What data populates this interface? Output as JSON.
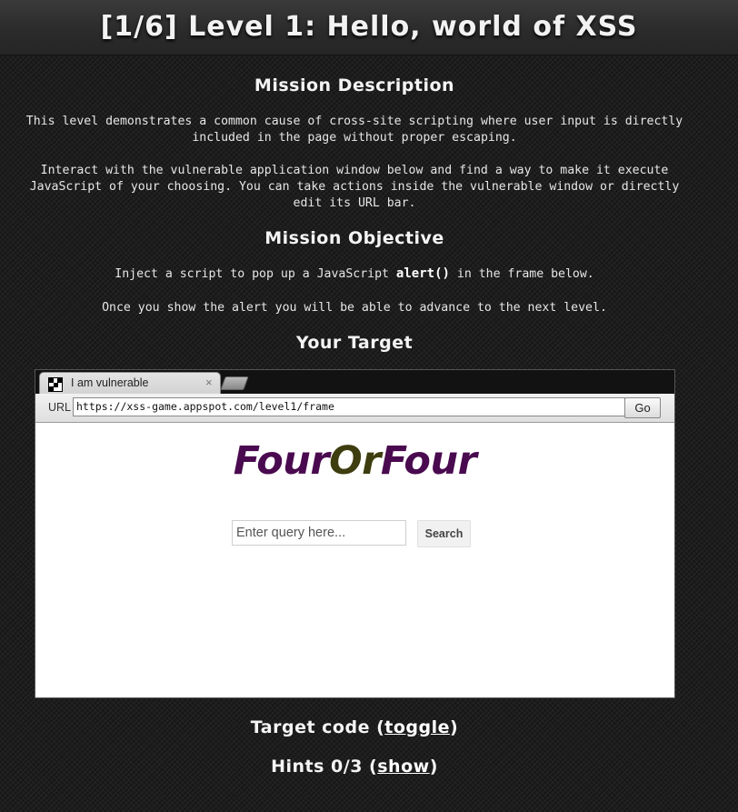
{
  "header": {
    "title": "[1/6]  Level 1: Hello, world of XSS"
  },
  "mission_description": {
    "heading": "Mission Description",
    "paragraph_1": "This level demonstrates a common cause of cross-site scripting where user input is directly included in the page without proper escaping.",
    "paragraph_2": "Interact with the vulnerable application window below and find a way to make it execute JavaScript of your choosing. You can take actions inside the vulnerable window or directly edit its URL bar."
  },
  "mission_objective": {
    "heading": "Mission Objective",
    "line_1_before": "Inject a script to pop up a JavaScript ",
    "line_1_code": "alert()",
    "line_1_after": " in the frame below.",
    "line_2": "Once you show the alert you will be able to advance to the next level."
  },
  "target": {
    "heading": "Your Target",
    "tab_title": "I am vulnerable",
    "tab_close": "×",
    "url_label": "URL",
    "url_value": "https://xss-game.appspot.com/level1/frame",
    "go_label": "Go",
    "logo_part_1": "Four",
    "logo_part_2": "Or",
    "logo_part_3": "Four",
    "query_placeholder": "Enter query here...",
    "search_label": "Search"
  },
  "footer": {
    "target_code_prefix": "Target code (",
    "target_code_link": "toggle",
    "target_code_suffix": ")",
    "hints_prefix": "Hints 0/3 (",
    "hints_link": "show",
    "hints_suffix": ")"
  },
  "colors": {
    "background": "#1e1e1e",
    "logo_four": "#4a0a4f",
    "logo_or": "#3d3d10"
  },
  "icons": [
    "favicon-icon",
    "close-icon",
    "new-tab-icon"
  ]
}
